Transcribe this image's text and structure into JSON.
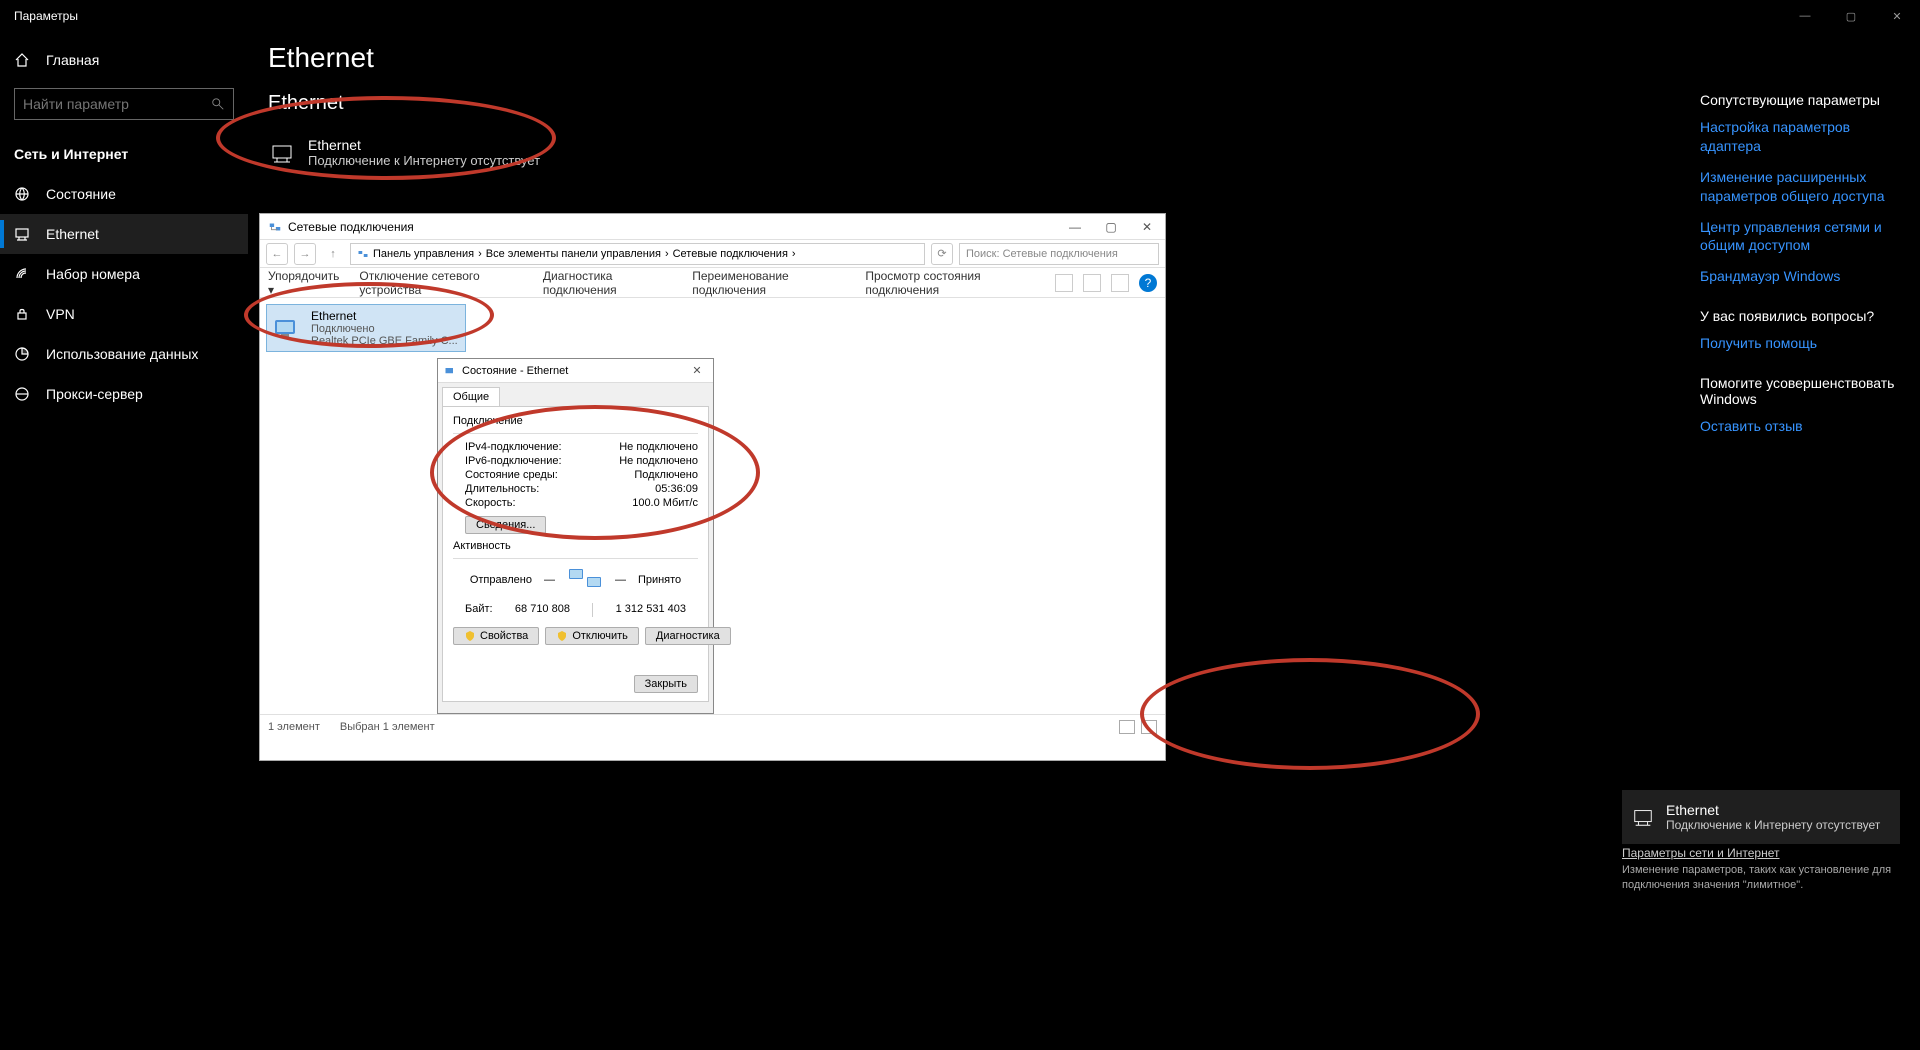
{
  "titlebar": {
    "title": "Параметры"
  },
  "sidebar": {
    "home": "Главная",
    "search_placeholder": "Найти параметр",
    "category": "Сеть и Интернет",
    "items": [
      {
        "label": "Состояние"
      },
      {
        "label": "Ethernet"
      },
      {
        "label": "Набор номера"
      },
      {
        "label": "VPN"
      },
      {
        "label": "Использование данных"
      },
      {
        "label": "Прокси-сервер"
      }
    ]
  },
  "main": {
    "h1": "Ethernet",
    "h2": "Ethernet",
    "eth_name": "Ethernet",
    "eth_status": "Подключение к Интернету отсутствует"
  },
  "right": {
    "hdr1": "Сопутствующие параметры",
    "links1": [
      "Настройка параметров адаптера",
      "Изменение расширенных параметров общего доступа",
      "Центр управления сетями и общим доступом",
      "Брандмауэр Windows"
    ],
    "hdr2": "У вас появились вопросы?",
    "link2": "Получить помощь",
    "hdr3": "Помогите усовершенствовать Windows",
    "link3": "Оставить отзыв"
  },
  "nc": {
    "title": "Сетевые подключения",
    "breadcrumb": [
      "Панель управления",
      "Все элементы панели управления",
      "Сетевые подключения"
    ],
    "search_placeholder": "Поиск: Сетевые подключения",
    "toolbar": [
      "Упорядочить ▾",
      "Отключение сетевого устройства",
      "Диагностика подключения",
      "Переименование подключения",
      "Просмотр состояния подключения"
    ],
    "item": {
      "name": "Ethernet",
      "state": "Подключено",
      "adapter": "Realtek PCIe GBE Family C..."
    },
    "status_left": "1 элемент",
    "status_sel": "Выбран 1 элемент"
  },
  "st": {
    "title": "Состояние - Ethernet",
    "tab": "Общие",
    "sec_conn": "Подключение",
    "rows": [
      {
        "k": "IPv4-подключение:",
        "v": "Не подключено"
      },
      {
        "k": "IPv6-подключение:",
        "v": "Не подключено"
      },
      {
        "k": "Состояние среды:",
        "v": "Подключено"
      },
      {
        "k": "Длительность:",
        "v": "05:36:09"
      },
      {
        "k": "Скорость:",
        "v": "100.0 Мбит/с"
      }
    ],
    "details_btn": "Сведения...",
    "sec_act": "Активность",
    "sent_label": "Отправлено",
    "recv_label": "Принято",
    "bytes_label": "Байт:",
    "bytes_sent": "68 710 808",
    "bytes_recv": "1 312 531 403",
    "btn_props": "Свойства",
    "btn_disable": "Отключить",
    "btn_diag": "Диагностика",
    "btn_close": "Закрыть"
  },
  "flyout": {
    "name": "Ethernet",
    "status": "Подключение к Интернету отсутствует",
    "footer_h": "Параметры сети и Интернет",
    "footer_t": "Изменение параметров, таких как установление для подключения значения \"лимитное\"."
  }
}
